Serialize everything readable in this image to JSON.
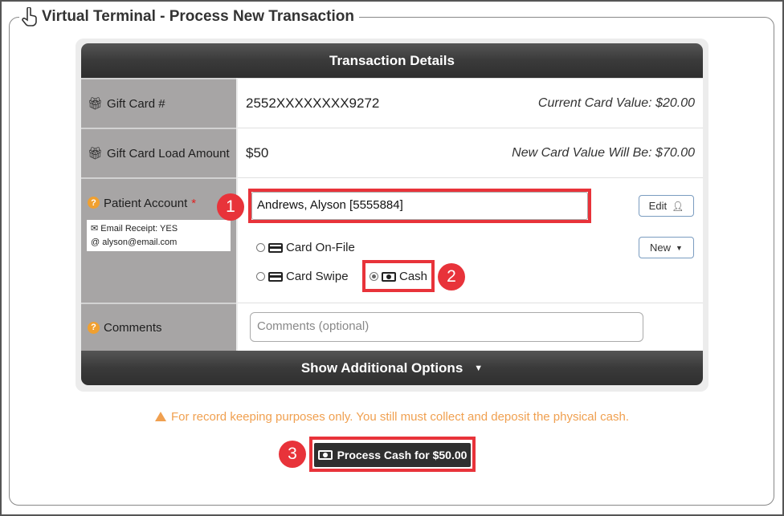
{
  "page": {
    "title": "Virtual Terminal - Process New Transaction"
  },
  "panel": {
    "header": "Transaction Details",
    "footer_toggle": "Show Additional Options"
  },
  "gift_card": {
    "label": "Gift Card #",
    "number": "2552XXXXXXXX9272",
    "current_value": "Current Card Value: $20.00"
  },
  "load_amount": {
    "label": "Gift Card Load Amount",
    "amount": "$50",
    "new_value": "New Card Value Will Be: $70.00"
  },
  "patient": {
    "label": "Patient Account",
    "required_mark": "*",
    "account_value": "Andrews, Alyson [5555884]",
    "email_receipt": "Email Receipt: YES",
    "email": "alyson@email.com",
    "edit_label": "Edit",
    "new_label": "New"
  },
  "payment_methods": {
    "card_on_file": "Card On-File",
    "card_swipe": "Card Swipe",
    "cash": "Cash",
    "selected": "Cash"
  },
  "comments": {
    "label": "Comments",
    "placeholder": "Comments (optional)"
  },
  "notice": "For record keeping purposes only. You still must collect and deposit the physical cash.",
  "submit_label": "Process Cash for $50.00",
  "callouts": [
    "1",
    "2",
    "3"
  ],
  "colors": {
    "callout_red": "#e8333a",
    "header_bar": "#3a3a3a",
    "label_cell": "#a7a5a5",
    "warning_orange": "#f0a050"
  }
}
